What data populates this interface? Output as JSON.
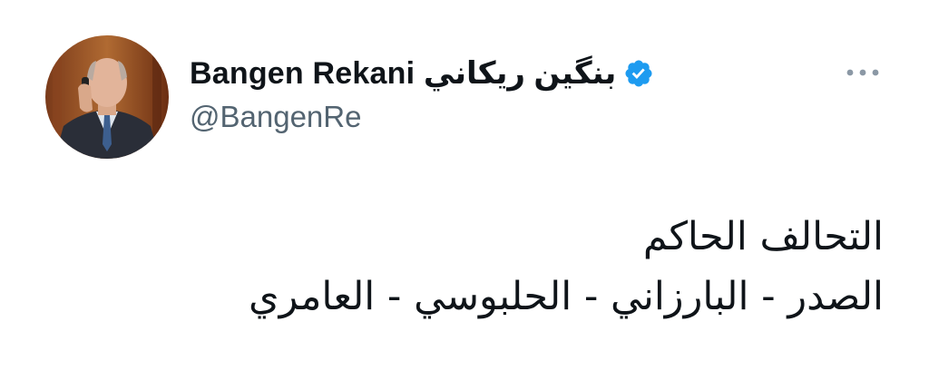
{
  "author": {
    "display_name": "Bangen Rekani بنگين ريكاني",
    "handle": "@BangenRe",
    "verified": true,
    "verified_icon": "verified-badge-icon",
    "avatar_icon": "profile-photo-avatar"
  },
  "menu": {
    "more_icon": "more-options-icon"
  },
  "tweet": {
    "lines": [
      "التحالف الحاكم",
      "الصدر - البارزاني - الحلبوسي - العامري"
    ]
  },
  "colors": {
    "text_primary": "#0f1419",
    "text_secondary": "#536471",
    "verified_blue": "#1d9bf0",
    "more_icon": "#8b98a5",
    "background": "#ffffff"
  }
}
